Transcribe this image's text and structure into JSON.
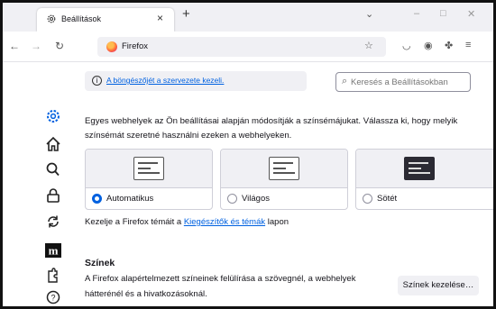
{
  "tab": {
    "title": "Beállítások"
  },
  "url": {
    "text": "Firefox"
  },
  "info_link": "A böngészőjét a szervezete kezeli.",
  "search": {
    "placeholder": "Keresés a Beállításokban"
  },
  "intro_text": "Egyes webhelyek az Ön beállításai alapján módosítják a színsémájukat. Válassza ki, hogy melyik színsémát szeretné használni ezeken a webhelyeken.",
  "schemes": [
    {
      "label": "Automatikus",
      "selected": true
    },
    {
      "label": "Világos",
      "selected": false
    },
    {
      "label": "Sötét",
      "selected": false
    }
  ],
  "themes_text": {
    "before": "Kezelje a Firefox témáit a ",
    "link": "Kiegészítők és témák",
    "after": " lapon"
  },
  "colors": {
    "heading": "Színek",
    "description": "A Firefox alapértelmezett színeinek felülírása a szövegnél, a webhelyek hátterénél és a hivatkozásoknál.",
    "button": "Színek kezelése…"
  },
  "icons": {
    "sidebar": [
      "gear-icon",
      "home-icon",
      "search-icon",
      "lock-icon",
      "sync-icon",
      "mozilla-icon",
      "extensions-icon",
      "help-icon"
    ]
  },
  "accent_color": "#0061e0"
}
